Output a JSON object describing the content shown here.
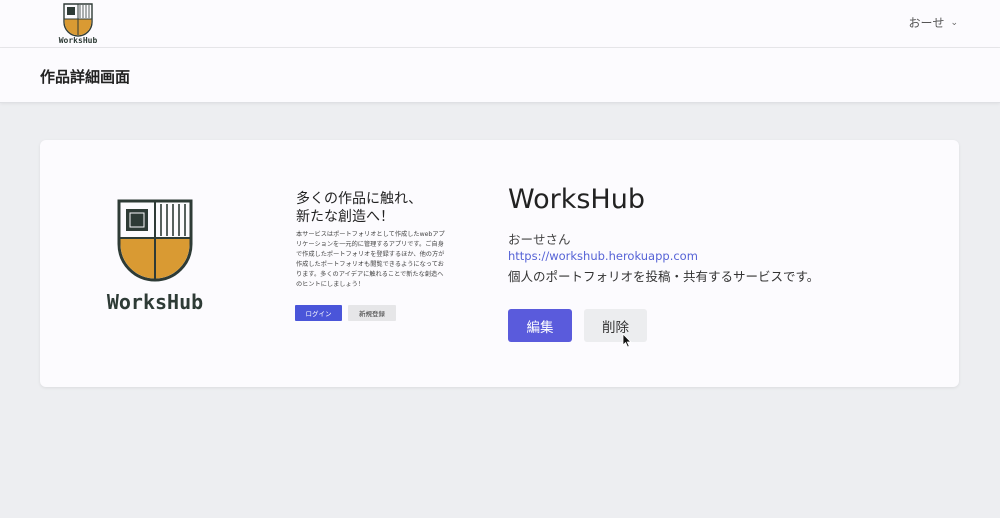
{
  "nav": {
    "logo_text": "WorksHub",
    "user_name": "おーせ",
    "chevron_icon": "chevron-down-icon"
  },
  "page": {
    "title": "作品詳細画面"
  },
  "work": {
    "thumbnail": {
      "logo_text": "WorksHub",
      "hero_title_line1": "多くの作品に触れ、",
      "hero_title_line2": "新たな創造へ！",
      "hero_text": "本サービスはポートフォリオとして作成したwebアプリケーションを一元的に管理するアプリです。ご自身で作成したポートフォリオを登録するほか、他の方が作成したポートフォリオも閲覧できるようになっております。多くのアイデアに触れることで新たな創造へのヒントにしましょう！",
      "login_label": "ログイン",
      "register_label": "新規登録"
    },
    "title": "WorksHub",
    "author": "おーせさん",
    "url": "https://workshub.herokuapp.com",
    "description": "個人のポートフォリオを投稿・共有するサービスです。",
    "edit_label": "編集",
    "delete_label": "削除"
  },
  "colors": {
    "primary": "#5a5bdc",
    "logo_dark": "#2e3b36",
    "logo_gold": "#d99a33",
    "link": "#5663d6"
  }
}
